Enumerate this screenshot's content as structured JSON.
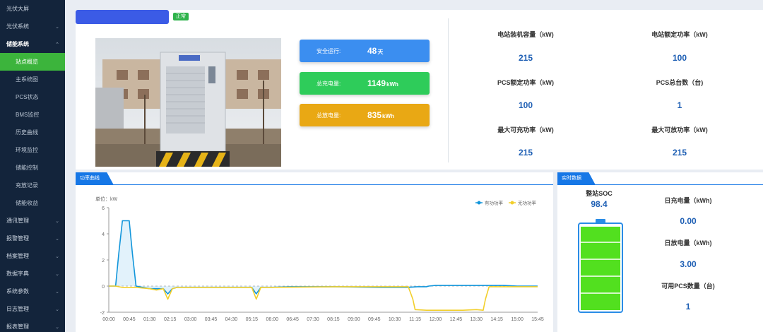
{
  "sidebar": {
    "items": [
      {
        "label": "光伏大屏",
        "expandable": false
      },
      {
        "label": "光伏系统",
        "expandable": true
      },
      {
        "label": "储能系统",
        "expandable": true,
        "open": true
      }
    ],
    "sub_items": [
      {
        "label": "站点概览",
        "active": true
      },
      {
        "label": "主系统图"
      },
      {
        "label": "PCS状态"
      },
      {
        "label": "BMS监控"
      },
      {
        "label": "历史曲线"
      },
      {
        "label": "环境监控"
      },
      {
        "label": "储能控制"
      },
      {
        "label": "充放记录"
      },
      {
        "label": "储能收益"
      }
    ],
    "items_after": [
      {
        "label": "通讯管理"
      },
      {
        "label": "报警管理"
      },
      {
        "label": "档案管理"
      },
      {
        "label": "数据字典"
      },
      {
        "label": "系统参数"
      },
      {
        "label": "日志管理"
      },
      {
        "label": "报表管理"
      }
    ]
  },
  "top": {
    "status": "正常",
    "cards": {
      "safe": {
        "label": "安全运行:",
        "value": "48",
        "unit": "天"
      },
      "charge": {
        "label": "总充电量:",
        "value": "1149",
        "unit": "kWh"
      },
      "discharge": {
        "label": "总放电量:",
        "value": "835",
        "unit": "kWh"
      }
    },
    "kpis": [
      {
        "label": "电站装机容量（kW)",
        "value": "215"
      },
      {
        "label": "电站额定功率（kW)",
        "value": "100"
      },
      {
        "label": "PCS额定功率（kW)",
        "value": "100"
      },
      {
        "label": "PCS总台数（台)",
        "value": "1"
      },
      {
        "label": "最大可充功率（kW)",
        "value": "215"
      },
      {
        "label": "最大可放功率（kW)",
        "value": "215"
      }
    ]
  },
  "power_panel": {
    "tab": "功率曲线"
  },
  "chart_data": {
    "type": "line",
    "unit_label": "单位：kW",
    "ylim": [
      -2,
      6
    ],
    "y_ticks": [
      6,
      4,
      2,
      0,
      -2
    ],
    "x_tick_labels": [
      "00:00",
      "00:45",
      "01:30",
      "02:15",
      "03:00",
      "03:45",
      "04:30",
      "05:15",
      "06:00",
      "06:45",
      "07:30",
      "08:15",
      "09:00",
      "09:45",
      "10:30",
      "11:15",
      "12:00",
      "12:45",
      "13:30",
      "14:15",
      "15:00",
      "15:45"
    ],
    "x_range_min": [
      0,
      945
    ],
    "legend_position": "top-right",
    "series": [
      {
        "name": "有功功率",
        "color": "#1296db",
        "points": [
          [
            0,
            0
          ],
          [
            15,
            0
          ],
          [
            22,
            2.5
          ],
          [
            30,
            5
          ],
          [
            45,
            5
          ],
          [
            52,
            2.5
          ],
          [
            60,
            0
          ],
          [
            90,
            -0.2
          ],
          [
            105,
            -0.2
          ],
          [
            120,
            -0.2
          ],
          [
            130,
            -0.6
          ],
          [
            140,
            -0.2
          ],
          [
            150,
            -0.1
          ],
          [
            165,
            -0.1
          ],
          [
            180,
            -0.1
          ],
          [
            270,
            -0.1
          ],
          [
            300,
            -0.1
          ],
          [
            315,
            -0.1
          ],
          [
            325,
            -0.6
          ],
          [
            335,
            -0.1
          ],
          [
            345,
            -0.1
          ],
          [
            360,
            -0.1
          ],
          [
            400,
            -0.05
          ],
          [
            500,
            -0.05
          ],
          [
            600,
            -0.1
          ],
          [
            630,
            -0.1
          ],
          [
            660,
            -0.1
          ],
          [
            680,
            -0.05
          ],
          [
            690,
            -0.05
          ],
          [
            700,
            -0.05
          ],
          [
            705,
            0
          ],
          [
            720,
            0.05
          ],
          [
            750,
            0.05
          ],
          [
            800,
            0.05
          ],
          [
            870,
            0.05
          ],
          [
            900,
            0
          ],
          [
            945,
            0
          ]
        ]
      },
      {
        "name": "无功功率",
        "color": "#f2cf2b",
        "points": [
          [
            0,
            0
          ],
          [
            15,
            0
          ],
          [
            30,
            -0.1
          ],
          [
            45,
            -0.1
          ],
          [
            60,
            -0.1
          ],
          [
            90,
            -0.2
          ],
          [
            105,
            -0.3
          ],
          [
            120,
            -0.2
          ],
          [
            130,
            -1.0
          ],
          [
            140,
            -0.2
          ],
          [
            150,
            -0.1
          ],
          [
            180,
            -0.1
          ],
          [
            300,
            -0.1
          ],
          [
            315,
            -0.1
          ],
          [
            325,
            -1.0
          ],
          [
            335,
            -0.1
          ],
          [
            345,
            -0.1
          ],
          [
            360,
            -0.1
          ],
          [
            500,
            -0.05
          ],
          [
            600,
            -0.05
          ],
          [
            660,
            -0.05
          ],
          [
            670,
            -1.0
          ],
          [
            675,
            -1.8
          ],
          [
            700,
            -1.85
          ],
          [
            720,
            -1.85
          ],
          [
            780,
            -1.85
          ],
          [
            810,
            -1.8
          ],
          [
            825,
            -1.85
          ],
          [
            830,
            -1.0
          ],
          [
            838,
            -0.05
          ],
          [
            870,
            -0.05
          ],
          [
            900,
            -0.05
          ],
          [
            945,
            -0.05
          ]
        ]
      }
    ]
  },
  "realtime": {
    "tab": "实时数据",
    "soc_title": "整站SOC",
    "soc_value": "98.4",
    "soc_fraction": 0.984,
    "day_charge_label": "日充电量（kWh)",
    "day_charge_value": "0.00",
    "day_discharge_label": "日放电量（kWh)",
    "day_discharge_value": "3.00",
    "pcs_label": "可用PCS数量（台)",
    "pcs_value": "1"
  },
  "colors": {
    "sidebar_bg": "#13243b",
    "active_green": "#3cb43c",
    "accent_blue": "#1677e6",
    "value_blue": "#1e5fb4",
    "battery_green": "#52e01f"
  }
}
